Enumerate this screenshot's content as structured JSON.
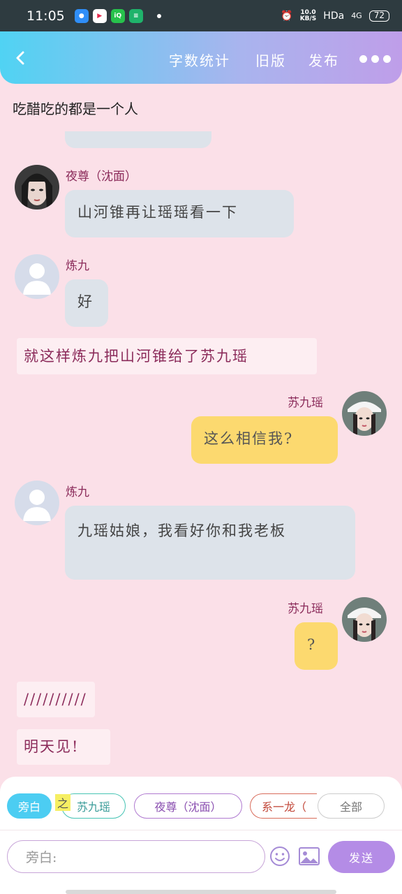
{
  "status_bar": {
    "time": "11:05",
    "net_speed_value": "10.0",
    "net_speed_unit": "KB/S",
    "hd": "HDa",
    "signal": "4G",
    "battery": "72"
  },
  "header": {
    "word_count": "字数统计",
    "old_version": "旧版",
    "publish": "发布"
  },
  "chat_title": "吃醋吃的都是一个人",
  "messages": [
    {
      "name": "夜尊（沈面）",
      "text": "山河锥再让瑶瑶看一下"
    },
    {
      "name": "炼九",
      "text": "好"
    },
    {
      "narration": "就这样炼九把山河锥给了苏九瑶"
    },
    {
      "name": "苏九瑶",
      "text": "这么相信我?"
    },
    {
      "name": "炼九",
      "text": "九瑶姑娘，我看好你和我老板"
    },
    {
      "name": "苏九瑶",
      "text": "?"
    },
    {
      "narration": "//////////"
    },
    {
      "narration": "明天见!"
    }
  ],
  "bottom": {
    "aside_chip": "旁白",
    "highlight": "之",
    "chip_1": "苏九瑶",
    "chip_2": "夜尊（沈面）",
    "chip_3": "系一龙（",
    "chip_all": "全部",
    "input_placeholder": "旁白:",
    "send": "发送"
  },
  "colors": {
    "background": "#fbe0e8",
    "header_start": "#50d3f3",
    "header_end": "#bf9ee9",
    "other_bubble": "#dde3ea",
    "my_bubble": "#fcd96f",
    "name_color": "#8b2b5a",
    "send_button": "#b48ce6"
  }
}
